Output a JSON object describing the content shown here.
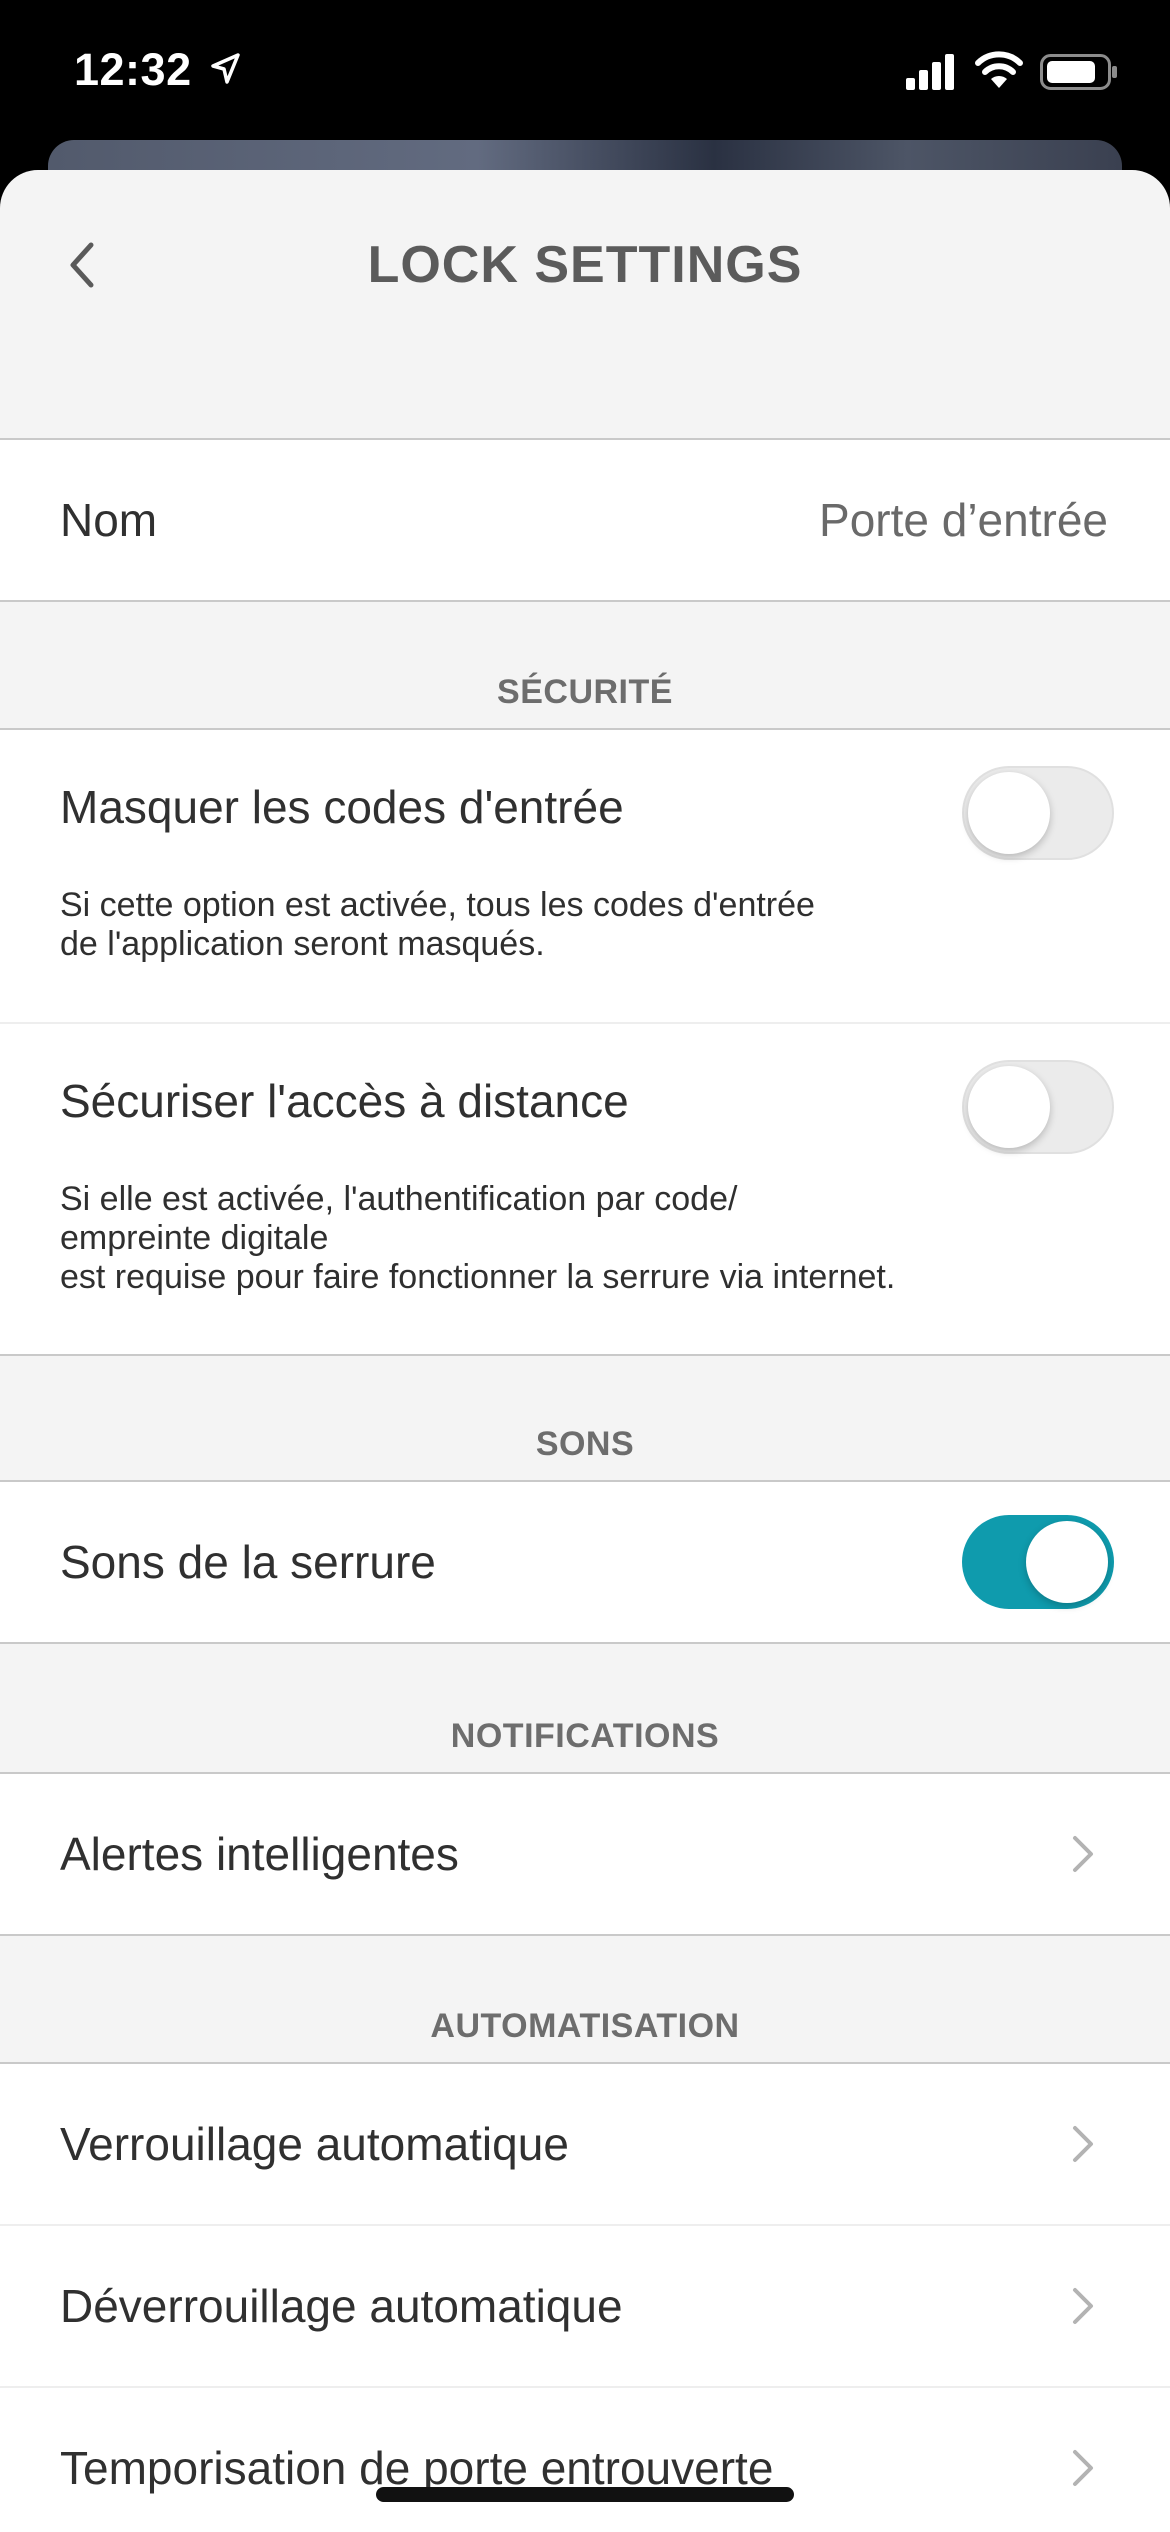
{
  "status_bar": {
    "time": "12:32",
    "battery_level": 0.75
  },
  "header": {
    "title": "LOCK SETTINGS"
  },
  "name_row": {
    "label": "Nom",
    "value": "Porte d’entrée"
  },
  "sections": {
    "security": {
      "title": "SÉCURITÉ",
      "hide_codes": {
        "label": "Masquer les codes d'entrée",
        "desc_line1": "Si cette option est activée, tous les codes d'entrée",
        "desc_line2": "de l'application seront masqués.",
        "enabled": false
      },
      "secure_remote": {
        "label": "Sécuriser l'accès à distance",
        "desc_line1": "Si elle est activée, l'authentification par code/",
        "desc_line2": "empreinte digitale",
        "desc_line3": "est requise pour faire fonctionner la serrure via internet.",
        "enabled": false
      }
    },
    "sounds": {
      "title": "SONS",
      "lock_sounds": {
        "label": "Sons de la serrure",
        "enabled": true
      }
    },
    "notifications": {
      "title": "NOTIFICATIONS",
      "smart_alerts": {
        "label": "Alertes intelligentes"
      }
    },
    "automation": {
      "title": "AUTOMATISATION",
      "auto_lock": {
        "label": "Verrouillage automatique"
      },
      "auto_unlock": {
        "label": "Déverrouillage automatique"
      },
      "door_ajar": {
        "label": "Temporisation de porte entrouverte"
      }
    }
  },
  "colors": {
    "accent": "#0f9bad",
    "background": "#f4f4f4",
    "separator": "#c9c9c9"
  }
}
